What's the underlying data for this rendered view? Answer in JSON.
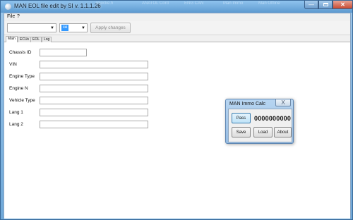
{
  "window": {
    "title": "MAN EOL file edit by SI v. 1.1.1.26",
    "minimize_glyph": "—",
    "maximize_glyph": "",
    "close_glyph": "✕"
  },
  "background_taskbar": [
    "Imocke.h",
    "ANATOL Cord",
    "ENG CAN",
    "Man Immo",
    "Man Offline"
  ],
  "menu": {
    "items": [
      "File",
      "?"
    ]
  },
  "toolbar": {
    "ecu_select_value": "",
    "language_value": "ce",
    "apply_label": "Apply changes",
    "dropdown_glyph": "▼"
  },
  "tabs": [
    {
      "label": "Main",
      "active": true
    },
    {
      "label": "ECUs",
      "active": false
    },
    {
      "label": "EOL",
      "active": false
    },
    {
      "label": "Log",
      "active": false
    }
  ],
  "fields": [
    {
      "label": "Chassis ID",
      "value": ""
    },
    {
      "label": "VIN",
      "value": ""
    },
    {
      "label": "Engine Type",
      "value": ""
    },
    {
      "label": "Engine N",
      "value": ""
    },
    {
      "label": "Vehicle Type",
      "value": ""
    },
    {
      "label": "Lang 1",
      "value": ""
    },
    {
      "label": "Lang 2",
      "value": ""
    }
  ],
  "immo_dialog": {
    "title": "MAN Immo Calc",
    "close_glyph": "X",
    "pass_label": "Pass",
    "pass_value": "0000000000",
    "save_label": "Save",
    "load_label": "Load",
    "about_label": "About"
  }
}
